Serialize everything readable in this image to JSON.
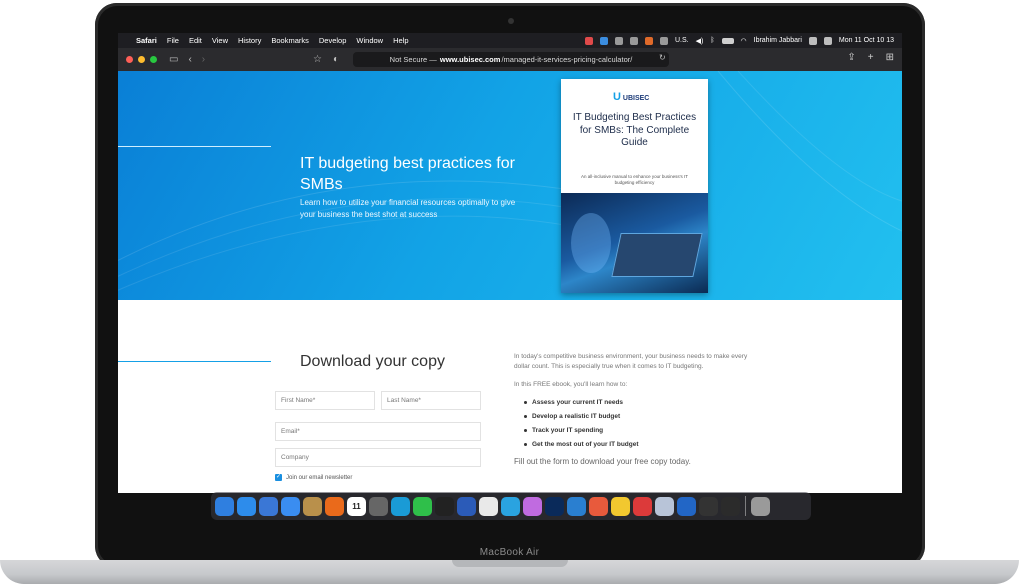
{
  "device": {
    "brand_label": "MacBook Air"
  },
  "menubar": {
    "apple": "",
    "app": "Safari",
    "items": [
      "File",
      "Edit",
      "View",
      "History",
      "Bookmarks",
      "Develop",
      "Window",
      "Help"
    ],
    "input_source": "U.S.",
    "user": "Ibrahim Jabbari",
    "clock": "Mon 11 Oct  10 13"
  },
  "toolbar": {
    "url_prefix": "Not Secure —",
    "url_domain": "www.ubisec.com",
    "url_path": "/managed-it-services-pricing-calculator/"
  },
  "hero": {
    "title": "IT budgeting best practices for SMBs",
    "subtitle": "Learn how to utilize your financial resources optimally to give your business the best shot at success"
  },
  "book": {
    "logo": "UBISEC",
    "title": "IT Budgeting Best Practices for SMBs: The Complete Guide",
    "description": "An all-inclusive manual to enhance your business's IT budgeting efficiency"
  },
  "form": {
    "heading": "Download your copy",
    "first_name": "First Name*",
    "last_name": "Last Name*",
    "email": "Email*",
    "company": "Company",
    "newsletter": "Join our email newsletter"
  },
  "info": {
    "intro": "In today's competitive business environment, your business needs to make every dollar count. This is especially true when it comes to IT budgeting.",
    "lead": "In this FREE ebook, you'll learn how to:",
    "bullets": [
      "Assess your current IT needs",
      "Develop a realistic IT budget",
      "Track your IT spending",
      "Get the most out of your IT budget"
    ],
    "cta": "Fill out the form to download your free copy today."
  },
  "dock": {
    "apps": [
      "finder-icon",
      "safari-icon",
      "compass-icon",
      "mail-icon",
      "notes-icon",
      "firefox-icon",
      "calendar-icon",
      "settings-icon",
      "skype-icon",
      "line-icon",
      "terminal-icon",
      "word-icon",
      "chrome-icon",
      "telegram-icon",
      "flower-icon",
      "photoshop-icon",
      "vscode-icon",
      "scrabble-icon",
      "smiley-icon",
      "app-icon",
      "preview-icon",
      "trello-icon",
      "tools-icon",
      "github-icon"
    ],
    "calendar_day": "11",
    "colors": [
      "#2f7fe0",
      "#2d8ceb",
      "#3a77d6",
      "#3a8df1",
      "#b9904b",
      "#ea6a1b",
      "#ffffff",
      "#666666",
      "#1a9bd6",
      "#2fbf4a",
      "#222222",
      "#2b5bb8",
      "#e9e9e9",
      "#2aa3e0",
      "#c06be0",
      "#0a2a5a",
      "#2a7fd0",
      "#e85a3c",
      "#f2c82f",
      "#dc3a3a",
      "#b8c4d8",
      "#2266c6",
      "#333333",
      "#2b2b2b"
    ],
    "trash": "trash-icon"
  }
}
